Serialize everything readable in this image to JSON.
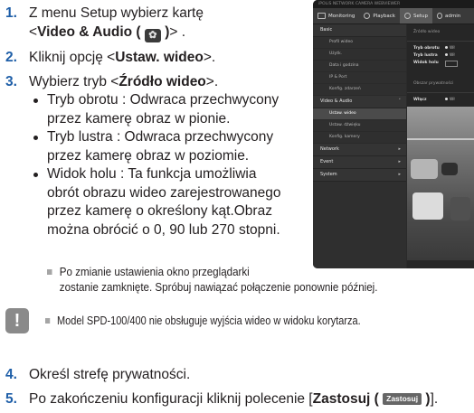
{
  "steps": [
    {
      "num": "1.",
      "line1": "Z menu Setup wybierz kartę",
      "line2_prefix": "<",
      "line2_bold": "Video & Audio (",
      "icon": "video-audio-icon",
      "line2_bold_close": ")",
      "line2_suffix": "> ."
    },
    {
      "num": "2.",
      "prefix": "Kliknij opcję <",
      "bold": "Ustaw. wideo",
      "suffix": ">."
    },
    {
      "num": "3.",
      "prefix": "Wybierz tryb <",
      "bold": "Źródło wideo",
      "suffix": ">."
    },
    {
      "num": "4.",
      "text": "Określ strefę prywatności."
    },
    {
      "num": "5.",
      "prefix": "Po zakończeniu konfiguracji kliknij polecenie [",
      "bold": "Zastosuj (",
      "button": "Zastosuj",
      "bold_close": ")",
      "suffix": "]."
    }
  ],
  "bullets": [
    [
      "Tryb obrotu : Odwraca przechwycony",
      "przez kamerę obraz w pionie."
    ],
    [
      "Tryb lustra : Odwraca przechwycony",
      "przez kamerę obraz w poziomie."
    ],
    [
      "Widok holu : Ta funkcja umożliwia",
      "obrót obrazu wideo zarejestrowanego",
      "przez kamerę o określony kąt.Obraz",
      "można obrócić o 0, 90 lub 270 stopni."
    ]
  ],
  "notes": {
    "reconnect_line1": "Po zmianie ustawienia okno przeglądarki",
    "reconnect_line2": "zostanie zamknięte. Spróbuj nawiązać połączenie ponownie później.",
    "model": "Model SPD-100/400 nie obsługuje wyjścia wideo w widoku korytarza.",
    "warning_icon": "exclamation-icon"
  },
  "screenshot": {
    "title": "iPOLiS NETWORK CAMERA WEBVIEWER",
    "menu": [
      {
        "label": "Monitoring",
        "icon": "monitor-icon"
      },
      {
        "label": "Playback",
        "icon": "playback-icon"
      },
      {
        "label": "Setup",
        "icon": "setup-icon",
        "active": true
      },
      {
        "label": "admin",
        "icon": "user-icon"
      }
    ],
    "sidebar": [
      {
        "section": "Basic",
        "items": [
          "Profil wideo",
          "Użytk.",
          "Data i godzina",
          "IP & Port",
          "Konfig. zdarzeń"
        ]
      },
      {
        "section": "Video & Audio",
        "items": [
          "Ustaw. wideo",
          "Ustaw. dźwięku",
          "Konfig. kamery"
        ]
      },
      {
        "section": "Network",
        "items": []
      },
      {
        "section": "Event",
        "items": []
      },
      {
        "section": "System",
        "items": []
      }
    ],
    "selected_item": "Ustaw. wideo",
    "content": {
      "heading": "Źródło wideo",
      "rows": [
        {
          "label": "Tryb obrotu",
          "value": "Wł"
        },
        {
          "label": "Tryb lustra",
          "value": "Wł"
        },
        {
          "label": "Widok holu",
          "value": ""
        }
      ],
      "privacy_heading": "Obszar prywatności",
      "privacy_row": {
        "label": "Włącz",
        "value": "Wł"
      }
    }
  }
}
